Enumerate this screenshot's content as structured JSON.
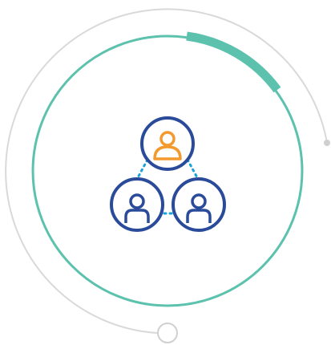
{
  "graphic": {
    "icon": "team-network-icon",
    "colors": {
      "outer_track": "#d9d9d9",
      "inner_ring": "#5cc2ae",
      "progress_arc": "#5cc2ae",
      "person_outline": "#2a4a9a",
      "leader_person": "#f29a2e",
      "connector": "#1aa3d9",
      "handle_fill": "#ffffff"
    },
    "progress_level": 0.12
  }
}
